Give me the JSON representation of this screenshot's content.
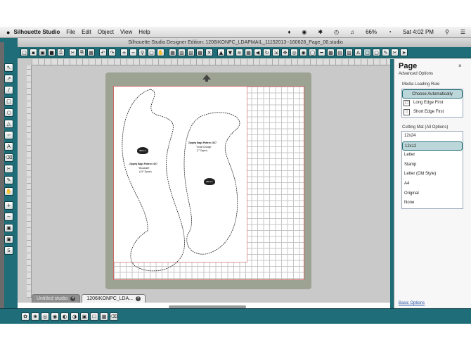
{
  "menubar": {
    "apple": "",
    "app_name": "Silhouette Studio",
    "items": [
      "File",
      "Edit",
      "Object",
      "View",
      "Help"
    ],
    "battery": "66%",
    "clock": "Sat 4:02 PM"
  },
  "window": {
    "title": "Silhouette Studio Designer Edition: 1206IKONPC_LDAPMAIL_11152013--160628_Page_06.studio"
  },
  "doc_tabs": [
    {
      "label": "Untitled studio",
      "active": false
    },
    {
      "label": "1206IKONPC_LDA...",
      "active": true
    }
  ],
  "page_panel": {
    "title": "Page",
    "close": "×",
    "subtitle": "Advanced Options",
    "media_label": "Media Loading Rule",
    "media_options": [
      {
        "label": "Choose Automatically",
        "selected": true,
        "icon": ""
      },
      {
        "label": "Long Edge First",
        "selected": false,
        "icon": "long-edge-icon"
      },
      {
        "label": "Short Edge First",
        "selected": false,
        "icon": "short-edge-icon"
      }
    ],
    "mat_label": "Cutting Mat (All Options)",
    "mat_options": [
      {
        "label": "12x24",
        "selected": false
      },
      {
        "label": "12x12",
        "selected": true
      },
      {
        "label": "Letter",
        "selected": false
      },
      {
        "label": "Stamp",
        "selected": false
      },
      {
        "label": "Letter (Old Style)",
        "selected": false
      },
      {
        "label": "A4",
        "selected": false
      },
      {
        "label": "Original",
        "selected": false
      },
      {
        "label": "None",
        "selected": false
      }
    ],
    "basic_options": "Basic Options"
  },
  "pattern": {
    "left_title": "Zippety Bags Pattern #107",
    "left_sub": "\"Bloodskill\"",
    "left_note": "(1/4\" Zipper)",
    "right_title": "Zippety Bags Pattern #107",
    "right_sub": "\"Small Change\"",
    "right_note": "(7\" Zipper)",
    "logo": "BELLA"
  },
  "colors": {
    "toolbar": "#1f6d78",
    "mat": "#9da392",
    "selected": "#bcd7da"
  }
}
